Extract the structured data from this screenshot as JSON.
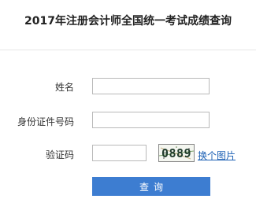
{
  "page": {
    "title": "2017年注册会计师全国统一考试成绩查询"
  },
  "form": {
    "name_label": "姓名",
    "name_value": "",
    "id_label": "身份证件号码",
    "id_value": "",
    "captcha_label": "验证码",
    "captcha_value": "",
    "captcha_image_text": "0889",
    "refresh_link": "换个图片",
    "submit_label": "查询"
  },
  "colors": {
    "submit_bg": "#3d7dd1",
    "link": "#1a5fb4"
  },
  "icons": {
    "captcha": "captcha-image"
  }
}
